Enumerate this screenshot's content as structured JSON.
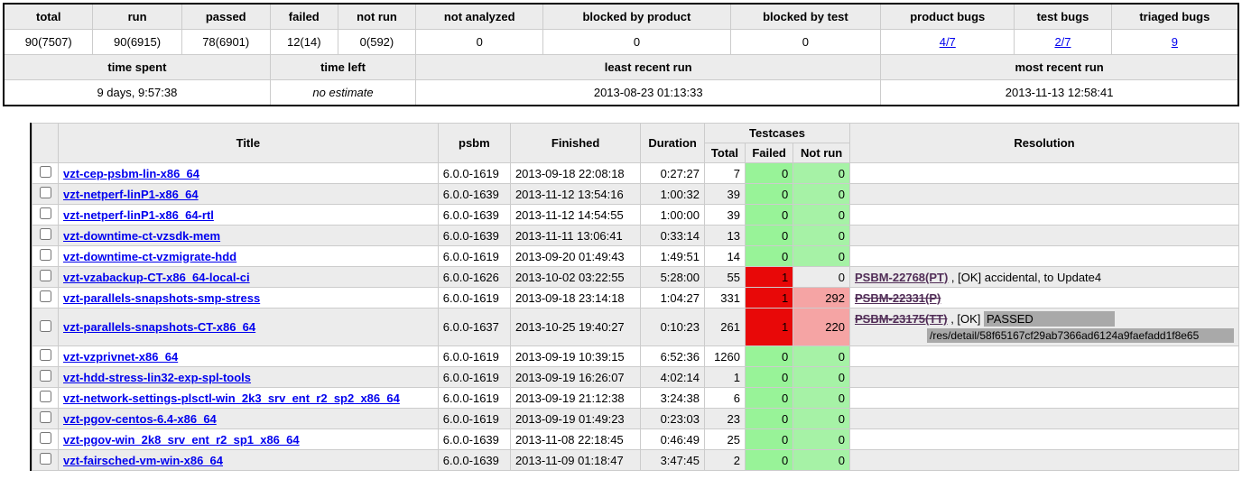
{
  "summary": {
    "headers1": [
      "total",
      "run",
      "passed",
      "failed",
      "not run",
      "not analyzed",
      "blocked by product",
      "blocked by test",
      "product bugs",
      "test bugs",
      "triaged bugs"
    ],
    "row1": [
      "90(7507)",
      "90(6915)",
      "78(6901)",
      "12(14)",
      "0(592)",
      "0",
      "0",
      "0",
      "4/7",
      "2/7",
      "9"
    ],
    "row1_links": [
      false,
      false,
      false,
      false,
      false,
      false,
      false,
      false,
      true,
      true,
      true
    ],
    "headers2": [
      "time spent",
      "time left",
      "least recent run",
      "most recent run"
    ],
    "row2": [
      "9 days, 9:57:38",
      "no estimate",
      "2013-08-23 01:13:33",
      "2013-11-13 12:58:41"
    ],
    "row2_italic": [
      false,
      true,
      false,
      false
    ],
    "spans2": [
      3,
      2,
      3,
      3
    ]
  },
  "table": {
    "headers": {
      "title": "Title",
      "psbm": "psbm",
      "finished": "Finished",
      "duration": "Duration",
      "testcases": "Testcases",
      "tc_total": "Total",
      "tc_failed": "Failed",
      "tc_notrun": "Not run",
      "resolution": "Resolution"
    },
    "rows": [
      {
        "title": "vzt-cep-psbm-lin-x86_64",
        "psbm": "6.0.0-1619",
        "finished": "2013-09-18 22:08:18",
        "duration": "0:27:27",
        "total": "7",
        "failed": "0",
        "failed_c": "f-green",
        "notrun": "0",
        "notrun_c": "f-lime",
        "res": []
      },
      {
        "title": "vzt-netperf-linP1-x86_64",
        "psbm": "6.0.0-1639",
        "finished": "2013-11-12 13:54:16",
        "duration": "1:00:32",
        "total": "39",
        "failed": "0",
        "failed_c": "f-green",
        "notrun": "0",
        "notrun_c": "f-lime",
        "res": []
      },
      {
        "title": "vzt-netperf-linP1-x86_64-rtl",
        "psbm": "6.0.0-1639",
        "finished": "2013-11-12 14:54:55",
        "duration": "1:00:00",
        "total": "39",
        "failed": "0",
        "failed_c": "f-green",
        "notrun": "0",
        "notrun_c": "f-lime",
        "res": []
      },
      {
        "title": "vzt-downtime-ct-vzsdk-mem",
        "psbm": "6.0.0-1639",
        "finished": "2013-11-11 13:06:41",
        "duration": "0:33:14",
        "total": "13",
        "failed": "0",
        "failed_c": "f-green",
        "notrun": "0",
        "notrun_c": "f-lime",
        "res": []
      },
      {
        "title": "vzt-downtime-ct-vzmigrate-hdd",
        "psbm": "6.0.0-1619",
        "finished": "2013-09-20 01:49:43",
        "duration": "1:49:51",
        "total": "14",
        "failed": "0",
        "failed_c": "f-green",
        "notrun": "0",
        "notrun_c": "f-lime",
        "res": []
      },
      {
        "title": "vzt-vzabackup-CT-x86_64-local-ci",
        "psbm": "6.0.0-1626",
        "finished": "2013-10-02 03:22:55",
        "duration": "5:28:00",
        "total": "55",
        "failed": "1",
        "failed_c": "f-red",
        "notrun": "0",
        "notrun_c": "",
        "res": [
          {
            "link": "PSBM-22768(PT)",
            "strike": false,
            "after": " , [OK] accidental, to Update4"
          }
        ]
      },
      {
        "title": "vzt-parallels-snapshots-smp-stress",
        "psbm": "6.0.0-1619",
        "finished": "2013-09-18 23:14:18",
        "duration": "1:04:27",
        "total": "331",
        "failed": "1",
        "failed_c": "f-red",
        "notrun": "292",
        "notrun_c": "f-pink",
        "res": [
          {
            "link": "PSBM-22331(P)",
            "strike": true,
            "after": ""
          }
        ]
      },
      {
        "title": "vzt-parallels-snapshots-CT-x86_64",
        "psbm": "6.0.0-1637",
        "finished": "2013-10-25 19:40:27",
        "duration": "0:10:23",
        "total": "261",
        "failed": "1",
        "failed_c": "f-red",
        "notrun": "220",
        "notrun_c": "f-pink",
        "res": [
          {
            "link": "PSBM-23175(TT)",
            "strike": true,
            "after": " , [OK] PASSED",
            "grey_after": true,
            "grey_sub": "/res/detail/58f65167cf29ab7366ad6124a9faefadd1f8e65"
          }
        ]
      },
      {
        "title": "vzt-vzprivnet-x86_64",
        "psbm": "6.0.0-1619",
        "finished": "2013-09-19 10:39:15",
        "duration": "6:52:36",
        "total": "1260",
        "failed": "0",
        "failed_c": "f-green",
        "notrun": "0",
        "notrun_c": "f-lime",
        "res": []
      },
      {
        "title": "vzt-hdd-stress-lin32-exp-spl-tools",
        "psbm": "6.0.0-1619",
        "finished": "2013-09-19 16:26:07",
        "duration": "4:02:14",
        "total": "1",
        "failed": "0",
        "failed_c": "f-green",
        "notrun": "0",
        "notrun_c": "f-lime",
        "res": []
      },
      {
        "title": "vzt-network-settings-plsctl-win_2k3_srv_ent_r2_sp2_x86_64",
        "psbm": "6.0.0-1619",
        "finished": "2013-09-19 21:12:38",
        "duration": "3:24:38",
        "total": "6",
        "failed": "0",
        "failed_c": "f-green",
        "notrun": "0",
        "notrun_c": "f-lime",
        "res": []
      },
      {
        "title": "vzt-pgov-centos-6.4-x86_64",
        "psbm": "6.0.0-1619",
        "finished": "2013-09-19 01:49:23",
        "duration": "0:23:03",
        "total": "23",
        "failed": "0",
        "failed_c": "f-green",
        "notrun": "0",
        "notrun_c": "f-lime",
        "res": []
      },
      {
        "title": "vzt-pgov-win_2k8_srv_ent_r2_sp1_x86_64",
        "psbm": "6.0.0-1639",
        "finished": "2013-11-08 22:18:45",
        "duration": "0:46:49",
        "total": "25",
        "failed": "0",
        "failed_c": "f-green",
        "notrun": "0",
        "notrun_c": "f-lime",
        "res": []
      },
      {
        "title": "vzt-fairsched-vm-win-x86_64",
        "psbm": "6.0.0-1639",
        "finished": "2013-11-09 01:18:47",
        "duration": "3:47:45",
        "total": "2",
        "failed": "0",
        "failed_c": "f-green",
        "notrun": "0",
        "notrun_c": "f-lime",
        "res": []
      }
    ]
  }
}
